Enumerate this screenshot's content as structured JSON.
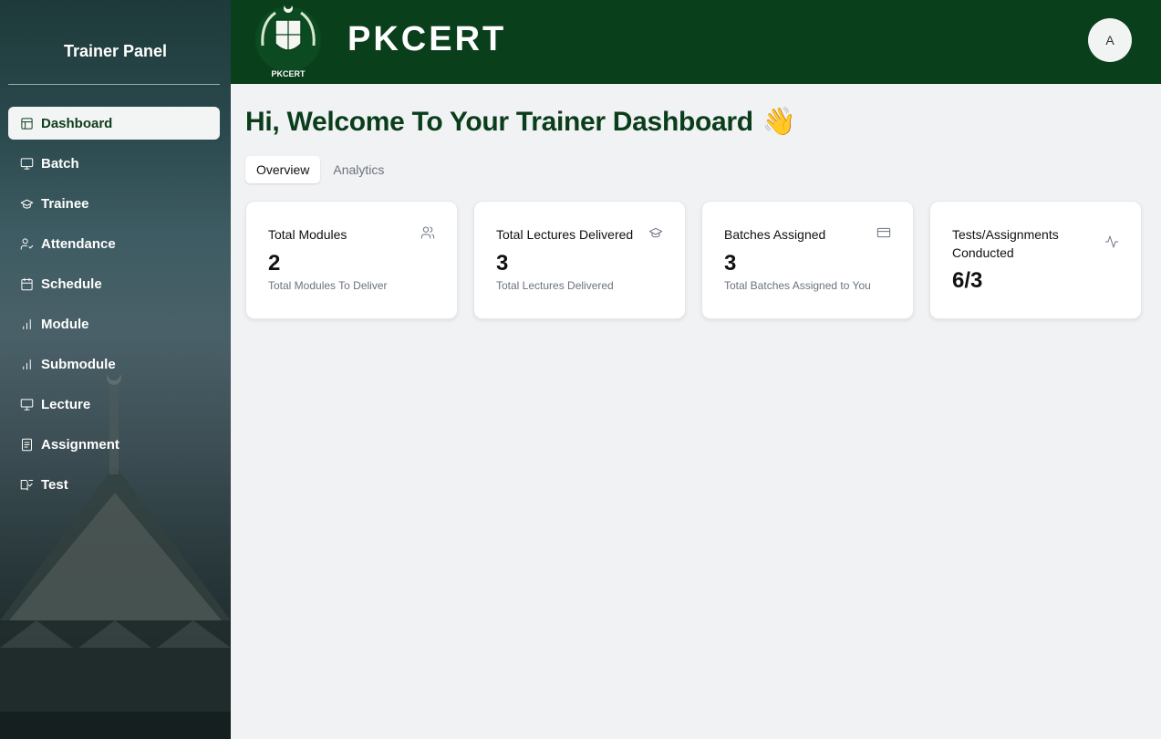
{
  "sidebar": {
    "title": "Trainer Panel",
    "items": [
      {
        "label": "Dashboard",
        "icon": "layout-dashboard-icon",
        "active": true
      },
      {
        "label": "Batch",
        "icon": "monitor-icon",
        "active": false
      },
      {
        "label": "Trainee",
        "icon": "graduation-cap-icon",
        "active": false
      },
      {
        "label": "Attendance",
        "icon": "user-check-icon",
        "active": false
      },
      {
        "label": "Schedule",
        "icon": "calendar-icon",
        "active": false
      },
      {
        "label": "Module",
        "icon": "bar-chart-icon",
        "active": false
      },
      {
        "label": "Submodule",
        "icon": "bar-chart-icon",
        "active": false
      },
      {
        "label": "Lecture",
        "icon": "presentation-icon",
        "active": false
      },
      {
        "label": "Assignment",
        "icon": "clipboard-icon",
        "active": false
      },
      {
        "label": "Test",
        "icon": "book-check-icon",
        "active": false
      }
    ]
  },
  "header": {
    "brand": "PKCERT",
    "logo_text": "PKCERT",
    "avatar_initial": "A"
  },
  "main": {
    "welcome": "Hi, Welcome To Your Trainer Dashboard",
    "welcome_emoji": "👋",
    "tabs": [
      {
        "label": "Overview",
        "active": true
      },
      {
        "label": "Analytics",
        "active": false
      }
    ],
    "cards": [
      {
        "title": "Total Modules",
        "value": "2",
        "subtitle": "Total Modules To Deliver",
        "icon": "users-icon"
      },
      {
        "title": "Total Lectures Delivered",
        "value": "3",
        "subtitle": "Total Lectures Delivered",
        "icon": "graduation-cap-icon"
      },
      {
        "title": "Batches Assigned",
        "value": "3",
        "subtitle": "Total Batches Assigned to You",
        "icon": "credit-card-icon"
      },
      {
        "title": "Tests/Assignments Conducted",
        "value": "6/3",
        "subtitle": "",
        "icon": "activity-icon"
      }
    ]
  },
  "colors": {
    "header_bg": "#0a3f1c",
    "heading": "#0a3d1c",
    "page_bg": "#f1f2f3"
  }
}
